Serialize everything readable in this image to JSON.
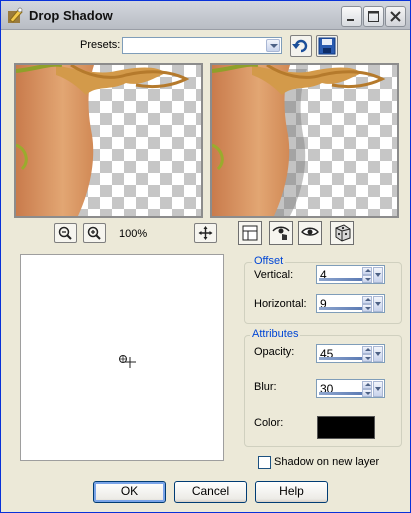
{
  "window": {
    "title": "Drop Shadow"
  },
  "presets": {
    "label": "Presets:",
    "value": ""
  },
  "preview": {
    "zoom": "100%"
  },
  "offset": {
    "group_title": "Offset",
    "vertical_label": "Vertical:",
    "vertical_value": "4",
    "horizontal_label": "Horizontal:",
    "horizontal_value": "9"
  },
  "attributes": {
    "group_title": "Attributes",
    "opacity_label": "Opacity:",
    "opacity_value": "45",
    "blur_label": "Blur:",
    "blur_value": "30",
    "color_label": "Color:",
    "color_value": "#000000"
  },
  "shadow_on_new_layer": {
    "label": "Shadow on new layer",
    "checked": false
  },
  "buttons": {
    "ok": "OK",
    "cancel": "Cancel",
    "help": "Help"
  },
  "colors": {
    "accent": "#0046d5",
    "chrome": "#ece9d8"
  }
}
